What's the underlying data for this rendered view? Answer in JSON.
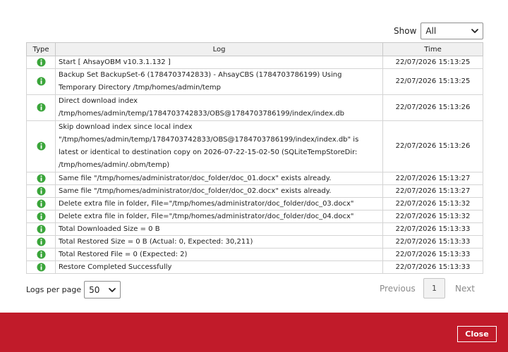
{
  "filter": {
    "show_label": "Show",
    "show_value": "All"
  },
  "table": {
    "headers": {
      "type": "Type",
      "log": "Log",
      "time": "Time"
    },
    "rows": [
      {
        "log": "Start [ AhsayOBM v10.3.1.132 ]",
        "time": "22/07/2026 15:13:25"
      },
      {
        "log": "Backup Set BackupSet-6 (1784703742833) - AhsayCBS (1784703786199) Using Temporary Directory /tmp/homes/admin/temp",
        "time": "22/07/2026 15:13:25"
      },
      {
        "log": "Direct download index /tmp/homes/admin/temp/1784703742833/OBS@1784703786199/index/index.db",
        "time": "22/07/2026 15:13:26"
      },
      {
        "log": "Skip download index since local index \"/tmp/homes/admin/temp/1784703742833/OBS@1784703786199/index/index.db\" is latest or identical to destination copy on 2026-07-22-15-02-50 (SQLiteTempStoreDir: /tmp/homes/admin/.obm/temp)",
        "time": "22/07/2026 15:13:26"
      },
      {
        "log": "Same file \"/tmp/homes/administrator/doc_folder/doc_01.docx\" exists already.",
        "time": "22/07/2026 15:13:27"
      },
      {
        "log": "Same file \"/tmp/homes/administrator/doc_folder/doc_02.docx\" exists already.",
        "time": "22/07/2026 15:13:27"
      },
      {
        "log": "Delete extra file in folder, File=\"/tmp/homes/administrator/doc_folder/doc_03.docx\"",
        "time": "22/07/2026 15:13:32"
      },
      {
        "log": "Delete extra file in folder, File=\"/tmp/homes/administrator/doc_folder/doc_04.docx\"",
        "time": "22/07/2026 15:13:32"
      },
      {
        "log": "Total Downloaded Size = 0 B",
        "time": "22/07/2026 15:13:33"
      },
      {
        "log": "Total Restored Size = 0 B (Actual: 0, Expected: 30,211)",
        "time": "22/07/2026 15:13:33"
      },
      {
        "log": "Total Restored File = 0 (Expected: 2)",
        "time": "22/07/2026 15:13:33"
      },
      {
        "log": "Restore Completed Successfully",
        "time": "22/07/2026 15:13:33"
      }
    ]
  },
  "pagination": {
    "logs_per_page_label": "Logs per page",
    "logs_per_page_value": "50",
    "previous_label": "Previous",
    "current_page": "1",
    "next_label": "Next"
  },
  "footer": {
    "close_label": "Close"
  },
  "colors": {
    "accent": "#c11b2a",
    "info_icon": "#3aa53a"
  },
  "icons": {
    "row_type": "info-icon",
    "dropdown": "chevron-down-icon"
  }
}
